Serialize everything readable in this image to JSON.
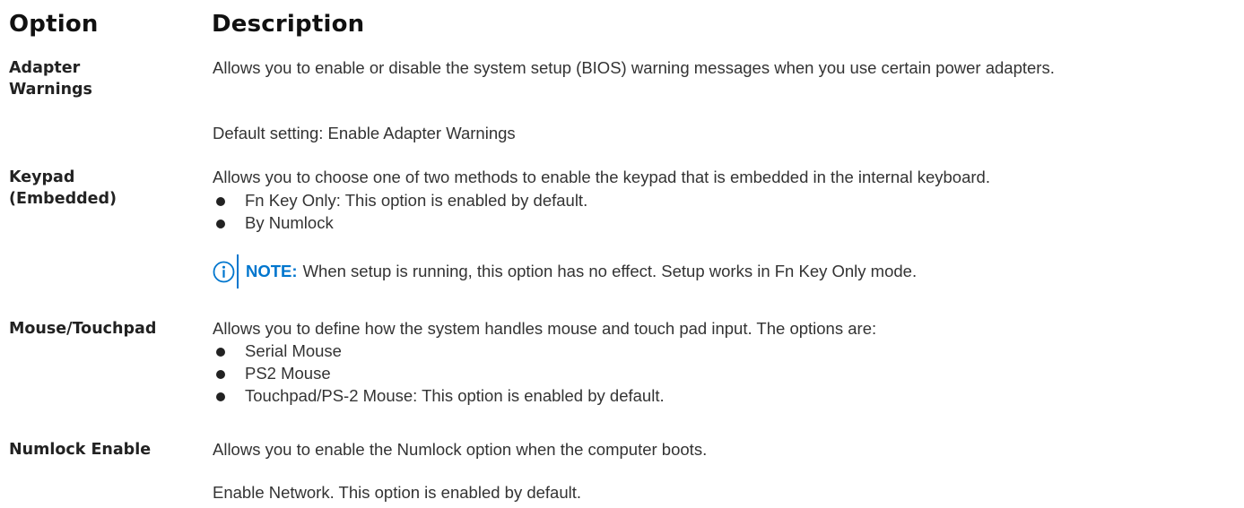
{
  "header": {
    "option": "Option",
    "description": "Description"
  },
  "rows": [
    {
      "option": "Adapter Warnings",
      "option_lines": [
        "Adapter",
        "Warnings"
      ],
      "description": "Allows you to enable or disable the system setup (BIOS) warning messages when you use certain power adapters.",
      "default": "Default setting: Enable Adapter Warnings"
    },
    {
      "option": "Keypad (Embedded)",
      "option_lines": [
        "Keypad",
        "(Embedded)"
      ],
      "description": "Allows you to choose one of two methods to enable the keypad that is embedded in the internal keyboard.",
      "bullets": [
        "Fn Key Only: This option is enabled by default.",
        "By Numlock"
      ],
      "note": {
        "icon": "info-icon",
        "label": "NOTE:",
        "text": "When setup is running, this option has no effect. Setup works in Fn Key Only mode."
      }
    },
    {
      "option": "Mouse/Touchpad",
      "description": "Allows you to define how the system handles mouse and touch pad input. The options are:",
      "bullets": [
        "Serial Mouse",
        "PS2 Mouse",
        "Touchpad/PS-2 Mouse: This option is enabled by default."
      ]
    },
    {
      "option": "Numlock Enable",
      "description": "Allows you to enable the Numlock option when the computer boots.",
      "extra": "Enable Network. This option is enabled by default."
    }
  ],
  "colors": {
    "accent": "#0076ce",
    "text": "#333333",
    "heading": "#111111"
  }
}
